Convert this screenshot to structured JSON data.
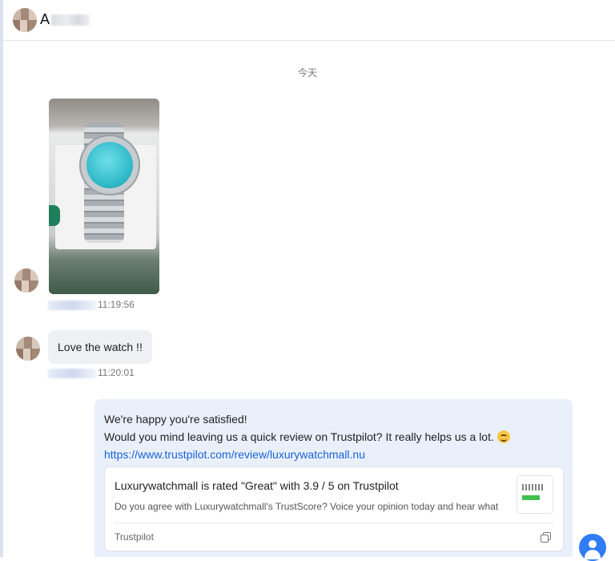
{
  "header": {
    "contact_name": "A"
  },
  "conversation": {
    "date_separator": "今天",
    "messages": [
      {
        "type": "image",
        "time": "11:19:56",
        "description_icon": "watch-photo"
      },
      {
        "type": "text",
        "text": "Love the watch !!",
        "time": "11:20:01"
      },
      {
        "type": "outgoing",
        "line1": "We're happy you're satisfied!",
        "line2": "Would you mind leaving us a quick review on Trustpilot? It really helps us a lot.",
        "link": "https://www.trustpilot.com/review/luxurywatchmall.nu",
        "preview": {
          "title": "Luxurywatchmall is rated \"Great\" with 3.9 / 5 on Trustpilot",
          "description": "Do you agree with Luxurywatchmall's TrustScore? Voice your opinion today and hear what ...",
          "source": "Trustpilot"
        }
      }
    ]
  },
  "colors": {
    "accent": "#2f7cf6",
    "link": "#1a63d8",
    "outgoing_bubble": "#eaf0fb",
    "incoming_bubble": "#eef0f3"
  }
}
